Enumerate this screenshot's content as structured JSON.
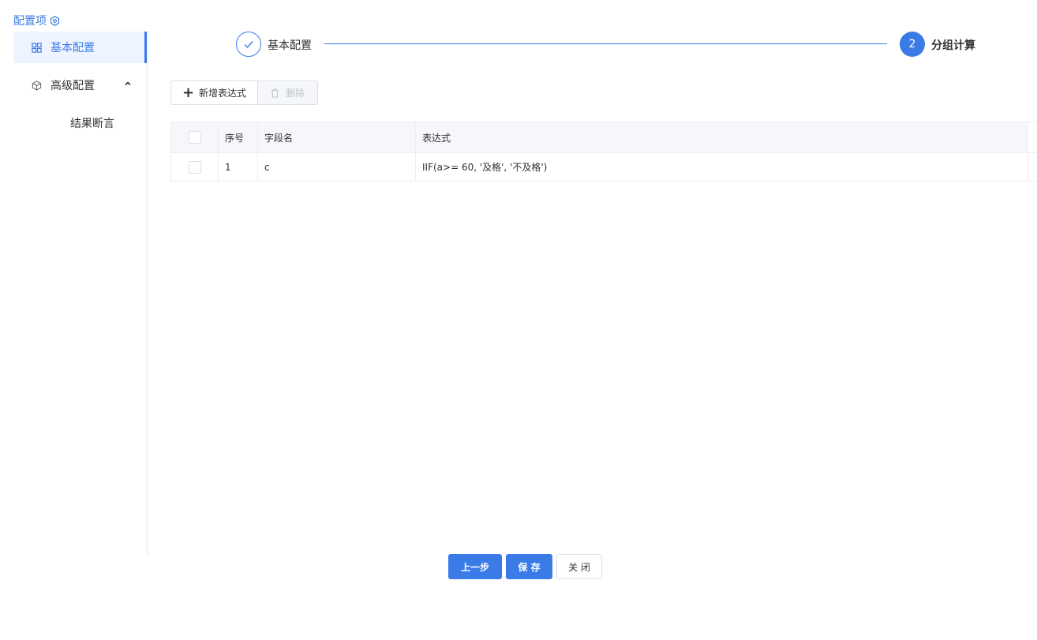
{
  "sidebar": {
    "title": "配置项",
    "items": [
      {
        "label": "基本配置",
        "icon": "grid-icon",
        "active": true
      },
      {
        "label": "高级配置",
        "icon": "cube-icon",
        "expanded": true
      },
      {
        "label": "结果断言",
        "child": true
      }
    ]
  },
  "steps": [
    {
      "label": "基本配置",
      "status": "done"
    },
    {
      "number": "2",
      "label": "分组计算",
      "status": "current"
    }
  ],
  "toolbar": {
    "add_label": "新增表达式",
    "delete_label": "删除"
  },
  "table": {
    "columns": [
      "序号",
      "字段名",
      "表达式"
    ],
    "rows": [
      {
        "index": "1",
        "field": "c",
        "expression": "IIF(a>= 60, '及格', '不及格')"
      }
    ]
  },
  "footer": {
    "prev_label": "上一步",
    "save_label": "保 存",
    "close_label": "关 闭"
  },
  "colors": {
    "accent": "#3b7be8",
    "border": "#ebeef5",
    "header_bg": "#f5f7fa"
  }
}
